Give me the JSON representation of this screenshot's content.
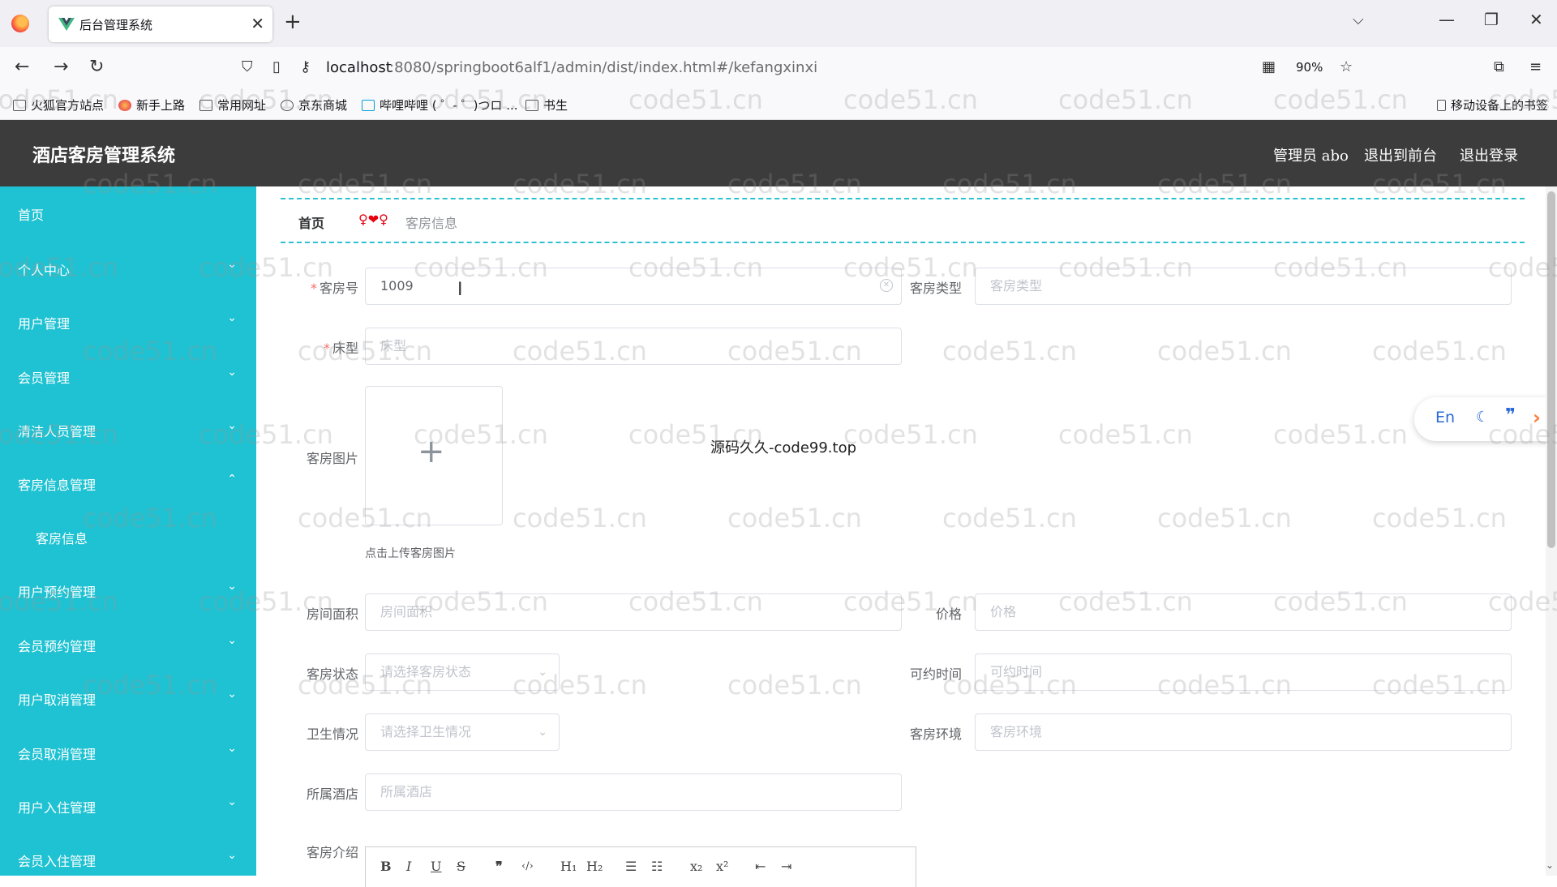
{
  "browser": {
    "tab_title": "后台管理系统",
    "url_host": "localhost",
    "url_path": ":8080/springboot6alf1/admin/dist/index.html#/kefangxinxi",
    "zoom": "90%",
    "bookmarks": [
      "火狐官方站点",
      "新手上路",
      "常用网址",
      "京东商城",
      "哔哩哔哩 ( ゜- ゜)つロ ...",
      "书生"
    ],
    "mobile_bookmarks": "移动设备上的书签"
  },
  "header": {
    "title": "酒店客房管理系统",
    "admin": "管理员 abo",
    "to_front": "退出到前台",
    "logout": "退出登录"
  },
  "sidebar": {
    "items": [
      {
        "label": "首页"
      },
      {
        "label": "个人中心"
      },
      {
        "label": "用户管理"
      },
      {
        "label": "会员管理"
      },
      {
        "label": "清洁人员管理"
      },
      {
        "label": "客房信息管理"
      },
      {
        "label": "客房信息"
      },
      {
        "label": "用户预约管理"
      },
      {
        "label": "会员预约管理"
      },
      {
        "label": "用户取消管理"
      },
      {
        "label": "会员取消管理"
      },
      {
        "label": "用户入住管理"
      },
      {
        "label": "会员入住管理"
      }
    ]
  },
  "breadcrumb": {
    "home": "首页",
    "separator": "❤",
    "current": "客房信息"
  },
  "form": {
    "room_no": {
      "label": "客房号",
      "value": "1009"
    },
    "room_type": {
      "label": "客房类型",
      "placeholder": "客房类型"
    },
    "bed_type": {
      "label": "床型",
      "placeholder": "床型"
    },
    "room_image": {
      "label": "客房图片",
      "tip": "点击上传客房图片"
    },
    "area": {
      "label": "房间面积",
      "placeholder": "房间面积"
    },
    "price": {
      "label": "价格",
      "placeholder": "价格"
    },
    "status": {
      "label": "客房状态",
      "placeholder": "请选择客房状态"
    },
    "avail_time": {
      "label": "可约时间",
      "placeholder": "可约时间"
    },
    "hygiene": {
      "label": "卫生情况",
      "placeholder": "请选择卫生情况"
    },
    "environment": {
      "label": "客房环境",
      "placeholder": "客房环境"
    },
    "hotel": {
      "label": "所属酒店",
      "placeholder": "所属酒店"
    },
    "intro": {
      "label": "客房介绍"
    }
  },
  "overlay_text": "源码久久-code99.top",
  "watermark": "code51.cn",
  "float_widget": {
    "lang": "En"
  },
  "colors": {
    "sidebar": "#1fc2d2",
    "header": "#3c3c3c",
    "accent": "#2cc2cf"
  }
}
